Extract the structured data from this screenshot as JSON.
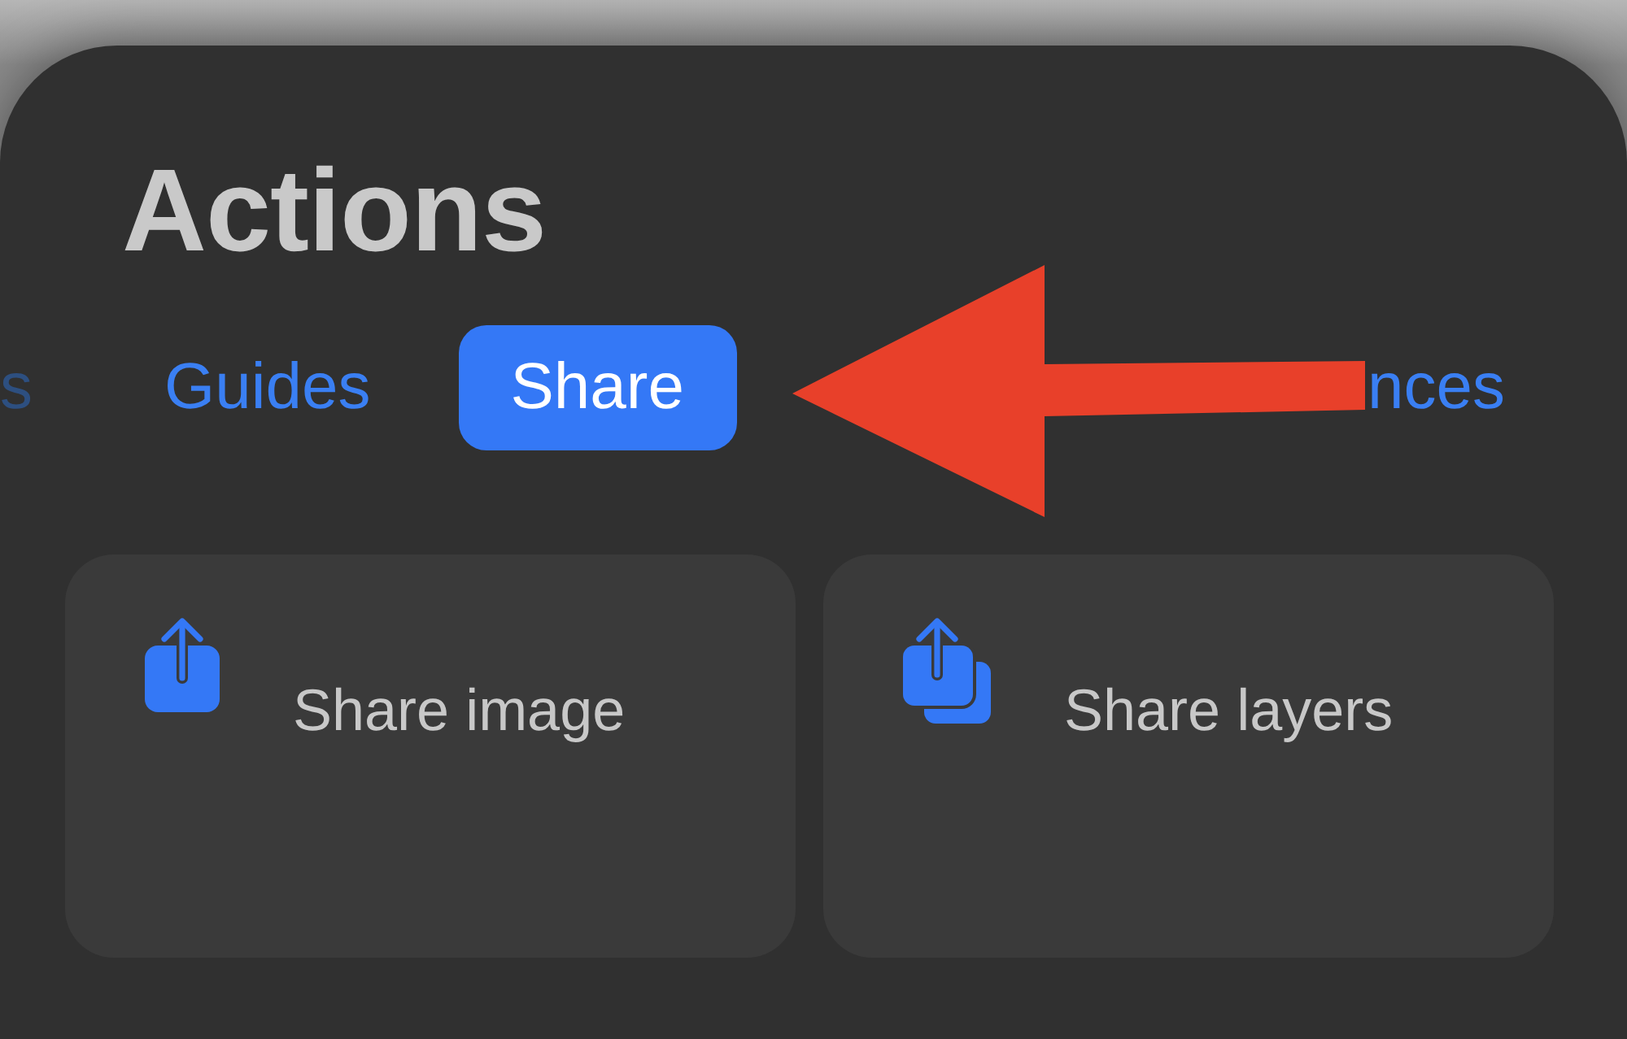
{
  "title": "Actions",
  "tabs": [
    {
      "label": "s",
      "selected": false
    },
    {
      "label": "Guides",
      "selected": false
    },
    {
      "label": "Share",
      "selected": true
    },
    {
      "label": "nces",
      "selected": false
    }
  ],
  "actions": [
    {
      "kind": "single",
      "label": "Share image"
    },
    {
      "kind": "stack",
      "label": "Share layers"
    }
  ]
}
